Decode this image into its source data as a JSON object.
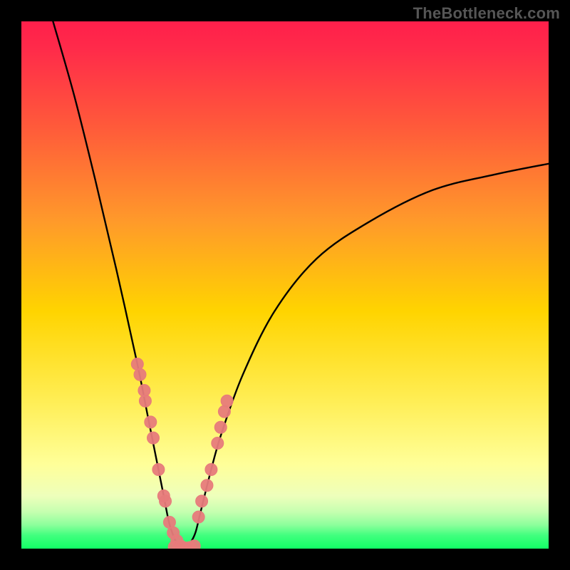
{
  "watermark": "TheBottleneck.com",
  "chart_data": {
    "type": "line",
    "title": "",
    "xlabel": "",
    "ylabel": "",
    "xlim": [
      0,
      100
    ],
    "ylim": [
      0,
      100
    ],
    "grid": false,
    "series": [
      {
        "name": "curve",
        "x": [
          6,
          10,
          14,
          18,
          22,
          24,
          26,
          27,
          28,
          29,
          30,
          31,
          32,
          33,
          34,
          36,
          38,
          42,
          48,
          56,
          66,
          78,
          90,
          100
        ],
        "y": [
          100,
          86,
          70,
          53,
          35,
          25,
          15,
          10,
          5,
          2,
          0,
          0,
          1,
          3,
          7,
          15,
          22,
          33,
          45,
          55,
          62,
          68,
          71,
          73
        ]
      },
      {
        "name": "left-dots",
        "x": [
          22.0,
          22.5,
          23.3,
          23.5,
          24.5,
          25.0,
          26.0,
          27.0,
          27.3,
          28.1,
          28.8,
          29.5,
          30.2
        ],
        "y": [
          35.0,
          33.0,
          30.0,
          28.0,
          24.0,
          21.0,
          15.0,
          10.0,
          9.0,
          5.0,
          3.0,
          1.5,
          0.5
        ]
      },
      {
        "name": "right-dots",
        "x": [
          33.6,
          34.2,
          35.2,
          36.0,
          37.2,
          37.8,
          38.5,
          39.0
        ],
        "y": [
          6.0,
          9.0,
          12.0,
          15.0,
          20.0,
          23.0,
          26.0,
          28.0
        ]
      },
      {
        "name": "bottom-dots",
        "x": [
          29.0,
          29.8,
          30.5,
          31.2,
          32.0,
          32.8
        ],
        "y": [
          0.3,
          0.1,
          0.1,
          0.1,
          0.2,
          0.5
        ]
      }
    ],
    "colors": {
      "curve": "#000000",
      "dots": "#e77b7b",
      "background_top": "#ff1f4b",
      "background_mid": "#ffd400",
      "background_low": "#ffff99",
      "background_base": "#12ff66"
    }
  }
}
